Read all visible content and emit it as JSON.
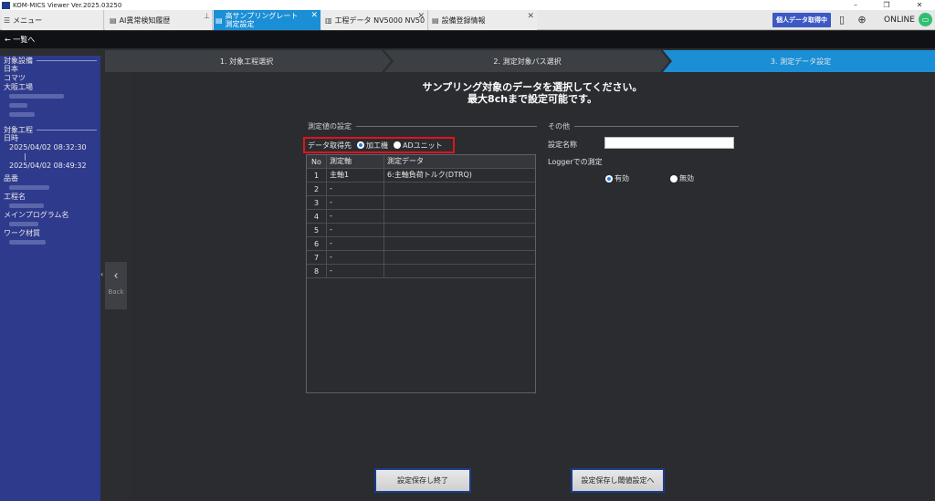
{
  "window": {
    "title": "KOM-MICS Viewer  Ver.2025.03250",
    "minimize_glyph": "–",
    "maximize_glyph": "❐",
    "close_glyph": "✕"
  },
  "tabs": {
    "menu_label": "メニュー",
    "ai_label": "AI異常検知履歴",
    "active_label_line1": "高サンプリングレート",
    "active_label_line2": "測定設定",
    "koutei_label": "工程データ NV5000 NV50",
    "setsubi_label": "設備登録情報",
    "close_glyph": "✕",
    "pin_glyph": "⊥"
  },
  "toolbar": {
    "personal_data_label": "個人データ取得中",
    "online_label": "ONLINE"
  },
  "nav": {
    "back_to_list": "← 一覧へ"
  },
  "sidebar": {
    "target_equipment_label": "対象設備",
    "equipment_lines": [
      "日本",
      "コマツ",
      "大阪工場"
    ],
    "target_process_label": "対象工程",
    "datetime_label": "日時",
    "start_time": "2025/04/02 08:32:30",
    "end_time": "2025/04/02 08:49:32",
    "part_no_label": "品番",
    "process_name_label": "工程名",
    "main_program_label": "メインプログラム名",
    "workpiece_label": "ワーク材質",
    "back_label": "Back"
  },
  "steps": [
    {
      "label": "1. 対象工程選択",
      "state": "done"
    },
    {
      "label": "2. 測定対象パス選択",
      "state": "done"
    },
    {
      "label": "3. 測定データ設定",
      "state": "active"
    }
  ],
  "colors": {
    "step_done": "#3c3f44",
    "step_active": "#1a8fd6",
    "sidebar": "#2e3a8c",
    "highlight_border": "#e2131b",
    "tab_active": "#1a8fd6"
  },
  "main": {
    "heading_line1": "サンプリング対象のデータを選択してください。",
    "heading_line2": "最大8chまで設定可能です。",
    "measure_section_label": "測定値の設定",
    "source_label": "データ取得先",
    "source_options": [
      "加工機",
      "ADユニット"
    ],
    "source_selected": "加工機",
    "table": {
      "headers": [
        "No",
        "測定軸",
        "測定データ"
      ],
      "rows": [
        {
          "no": "1",
          "axis": "主軸1",
          "data": "6:主軸負荷トルク(DTRQ)"
        },
        {
          "no": "2",
          "axis": "-",
          "data": ""
        },
        {
          "no": "3",
          "axis": "-",
          "data": ""
        },
        {
          "no": "4",
          "axis": "-",
          "data": ""
        },
        {
          "no": "5",
          "axis": "-",
          "data": ""
        },
        {
          "no": "6",
          "axis": "-",
          "data": ""
        },
        {
          "no": "7",
          "axis": "-",
          "data": ""
        },
        {
          "no": "8",
          "axis": "-",
          "data": ""
        }
      ]
    },
    "other_section_label": "その他",
    "setting_name_label": "設定名称",
    "setting_name_value": "",
    "logger_label": "Loggerでの測定",
    "logger_options": [
      "有効",
      "無効"
    ],
    "logger_selected": "有効"
  },
  "buttons": {
    "save_exit": "設定保存し終了",
    "save_threshold": "設定保存し閾値設定へ"
  }
}
